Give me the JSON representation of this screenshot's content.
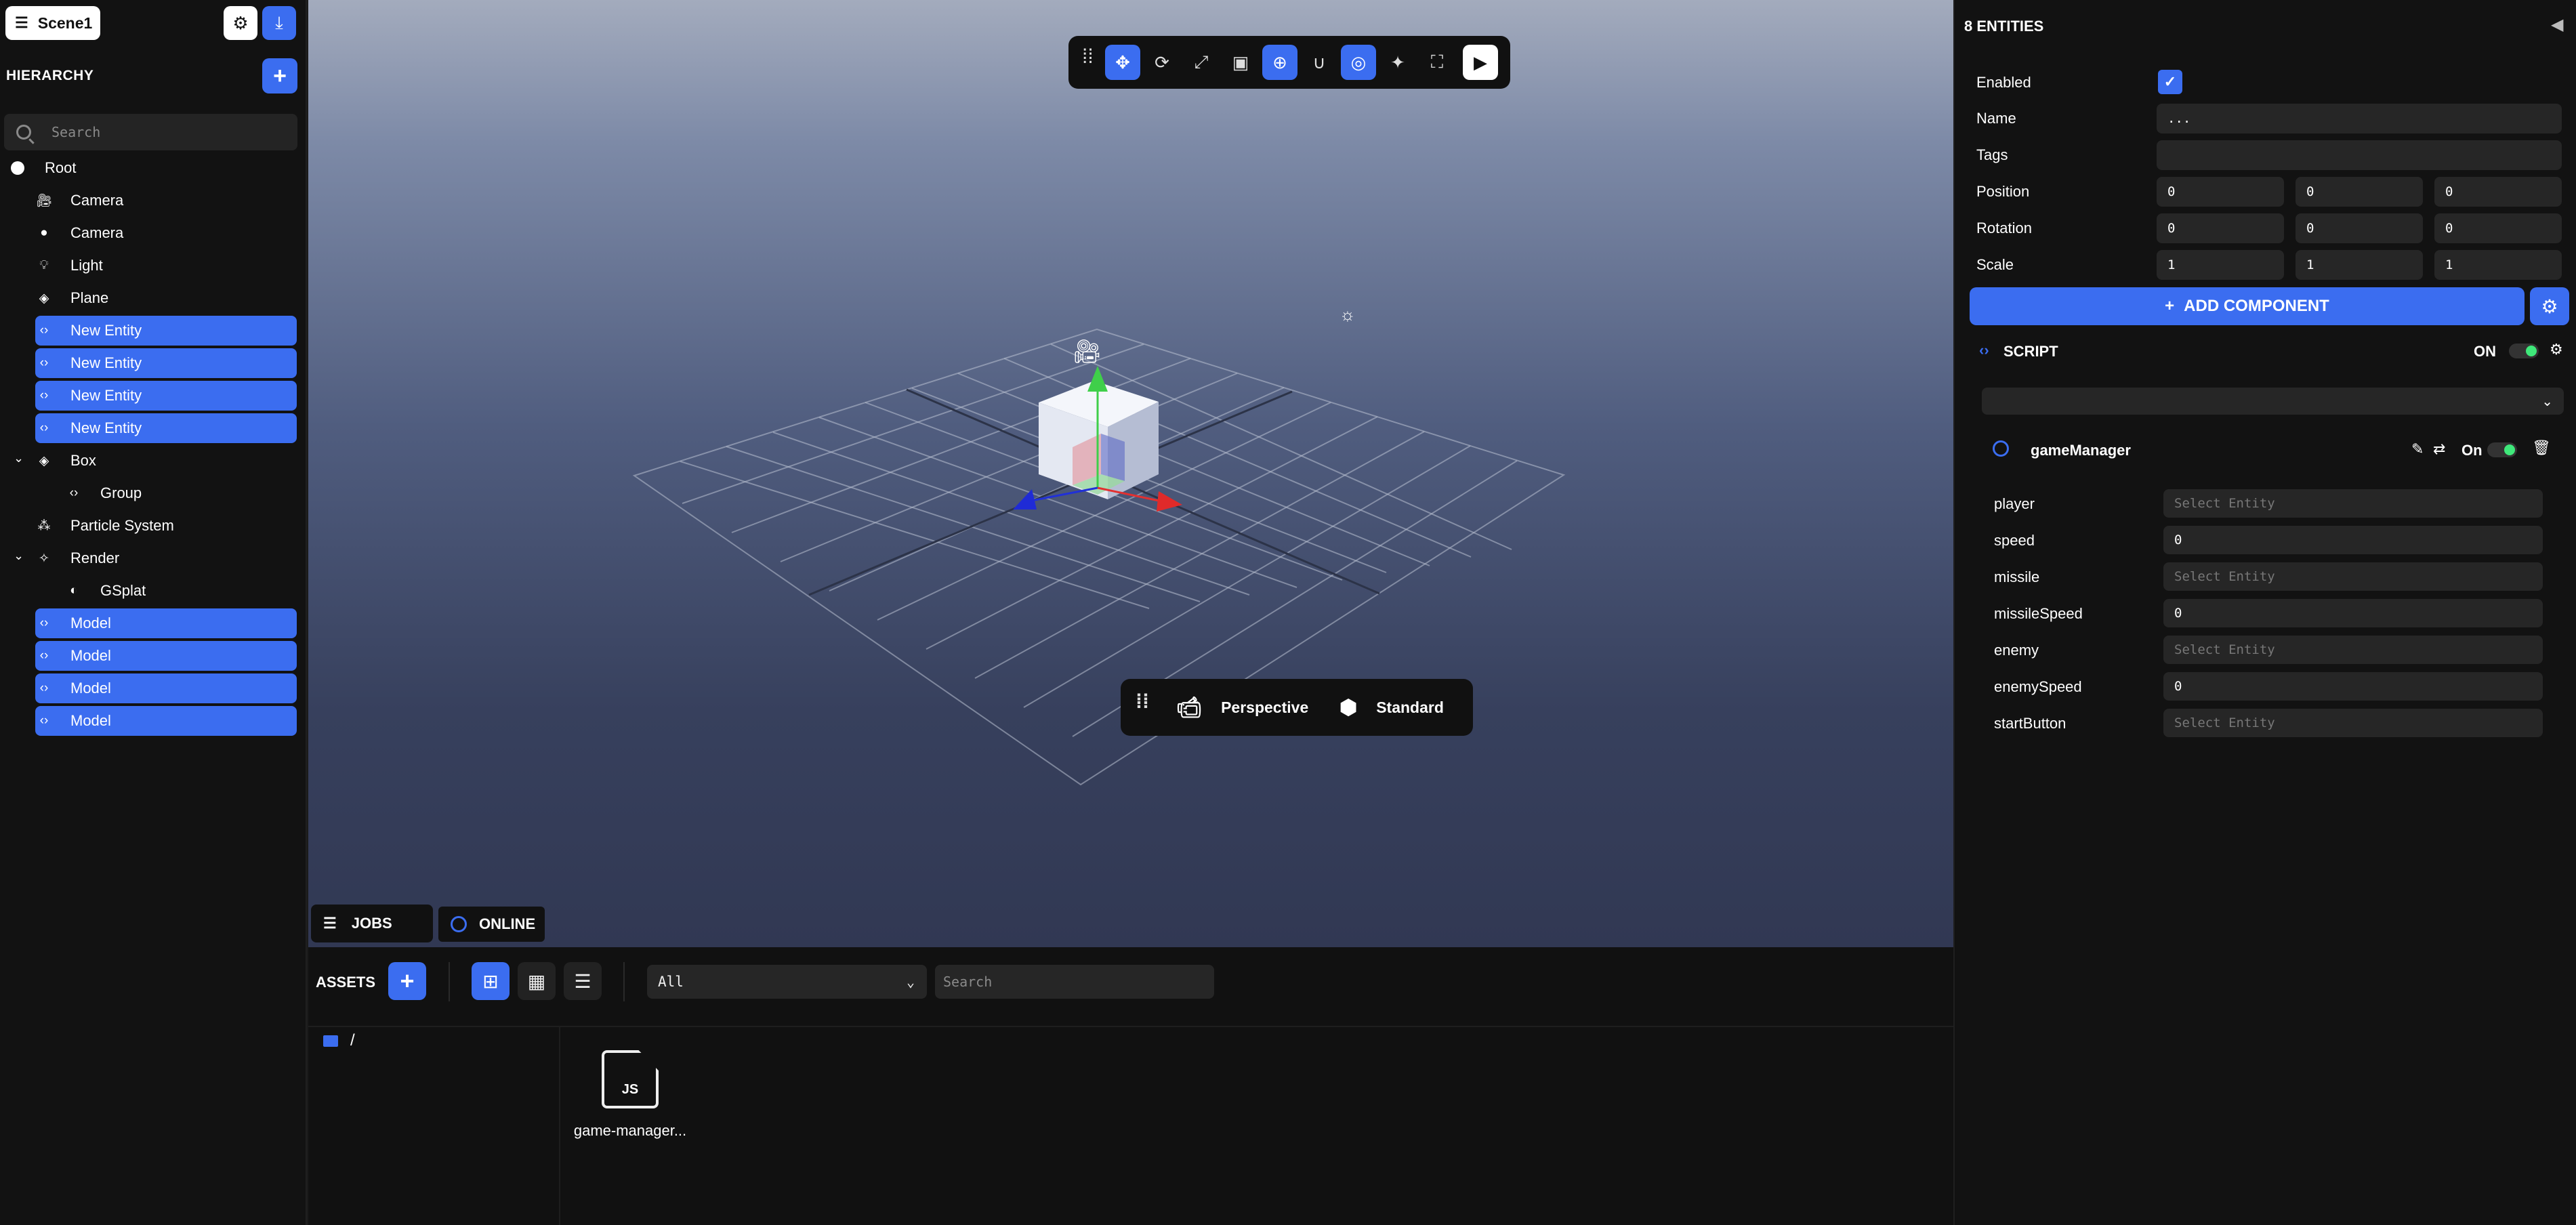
{
  "hierarchy": {
    "scene_label": "Scene1",
    "title": "HIERARCHY",
    "search_placeholder": "Search",
    "items": [
      {
        "label": "Root",
        "icon": "circle-icon"
      },
      {
        "label": "Camera",
        "icon": "camera-icon"
      },
      {
        "label": "Camera",
        "icon": "circle-icon"
      },
      {
        "label": "Light",
        "icon": "lightbulb-icon"
      },
      {
        "label": "Plane",
        "icon": "mesh-icon"
      },
      {
        "label": "New Entity",
        "icon": "code-icon"
      },
      {
        "label": "New Entity",
        "icon": "code-icon"
      },
      {
        "label": "New Entity",
        "icon": "code-icon"
      },
      {
        "label": "New Entity",
        "icon": "code-icon"
      },
      {
        "label": "Box",
        "icon": "mesh-icon"
      },
      {
        "label": "Group",
        "icon": "code-icon"
      },
      {
        "label": "Particle System",
        "icon": "particles-icon"
      },
      {
        "label": "Render",
        "icon": "render-icon"
      },
      {
        "label": "GSplat",
        "icon": "gsplat-icon"
      },
      {
        "label": "Model",
        "icon": "code-icon"
      },
      {
        "label": "Model",
        "icon": "code-icon"
      },
      {
        "label": "Model",
        "icon": "code-icon"
      },
      {
        "label": "Model",
        "icon": "code-icon"
      }
    ]
  },
  "viewport": {
    "camera_mode": "Perspective",
    "render_mode": "Standard",
    "jobs_label": "JOBS",
    "online_label": "ONLINE"
  },
  "assets": {
    "title": "ASSETS",
    "filter_value": "All",
    "search_placeholder": "Search",
    "folder_path": "/",
    "files": [
      {
        "name": "game-manager...",
        "type": "JS"
      }
    ]
  },
  "inspector": {
    "title": "8 ENTITIES",
    "labels": {
      "enabled": "Enabled",
      "name": "Name",
      "tags": "Tags",
      "position": "Position",
      "rotation": "Rotation",
      "scale": "Scale"
    },
    "name_value": "...",
    "tags_value": "",
    "position": [
      "0",
      "0",
      "0"
    ],
    "rotation": [
      "0",
      "0",
      "0"
    ],
    "scale": [
      "1",
      "1",
      "1"
    ],
    "add_component_label": "ADD COMPONENT",
    "script_section": {
      "title": "SCRIPT",
      "state": "ON",
      "script_name": "gameManager",
      "script_state": "On",
      "attributes": [
        {
          "label": "player",
          "value": "Select Entity",
          "placeholder": true
        },
        {
          "label": "speed",
          "value": "0",
          "placeholder": false
        },
        {
          "label": "missile",
          "value": "Select Entity",
          "placeholder": true
        },
        {
          "label": "missileSpeed",
          "value": "0",
          "placeholder": false
        },
        {
          "label": "enemy",
          "value": "Select Entity",
          "placeholder": true
        },
        {
          "label": "enemySpeed",
          "value": "0",
          "placeholder": false
        },
        {
          "label": "startButton",
          "value": "Select Entity",
          "placeholder": true
        }
      ]
    }
  },
  "colors": {
    "accent": "#3b6df0",
    "toggle_on": "#3fe87a",
    "panel_bg": "#121212"
  }
}
